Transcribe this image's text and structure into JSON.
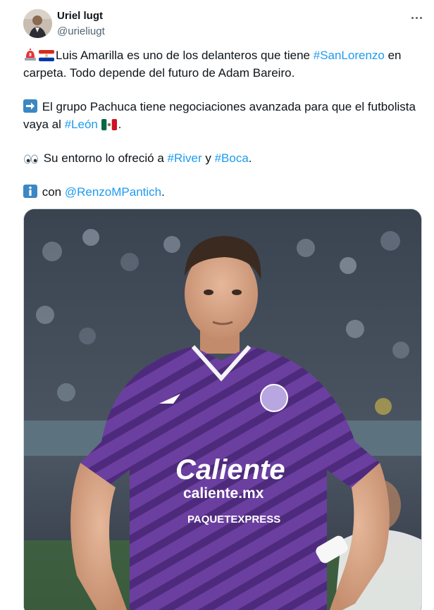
{
  "author": {
    "name": "Uriel lugt",
    "handle": "@urieliugt"
  },
  "menu": {
    "icon": "more-horizontal-icon"
  },
  "tweet": {
    "line1": {
      "icons": [
        "rotating-light-emoji",
        "paraguay-flag-emoji"
      ],
      "text_a": "Luis Amarilla es uno de los delanteros que tiene ",
      "hashtag": "#SanLorenzo",
      "text_b": " en carpeta. Todo depende del futuro de Adam Bareiro."
    },
    "line2": {
      "icon": "right-arrow-emoji",
      "text_a": " El grupo Pachuca tiene negociaciones avanzada para que el futbolista vaya al ",
      "hashtag": "#León",
      "flag_icon": "mexico-flag-emoji",
      "text_b": "."
    },
    "line3": {
      "icon": "eyes-emoji",
      "text_a": " Su entorno lo ofreció a ",
      "hashtag_1": "#River",
      "text_b": " y ",
      "hashtag_2": "#Boca",
      "text_c": "."
    },
    "line4": {
      "icon": "information-emoji",
      "text_a": " con ",
      "mention": "@RenzoMPantich",
      "text_b": "."
    }
  },
  "media": {
    "description_icon": "player-photo",
    "jersey_sponsor": "Caliente",
    "jersey_sponsor_url": "caliente.mx",
    "jersey_sleeve_text": "PAQUETEXPRESS"
  },
  "colors": {
    "link": "#1d9bf0",
    "text": "#0f1419",
    "muted": "#536471",
    "jersey": "#6b3fa0"
  }
}
